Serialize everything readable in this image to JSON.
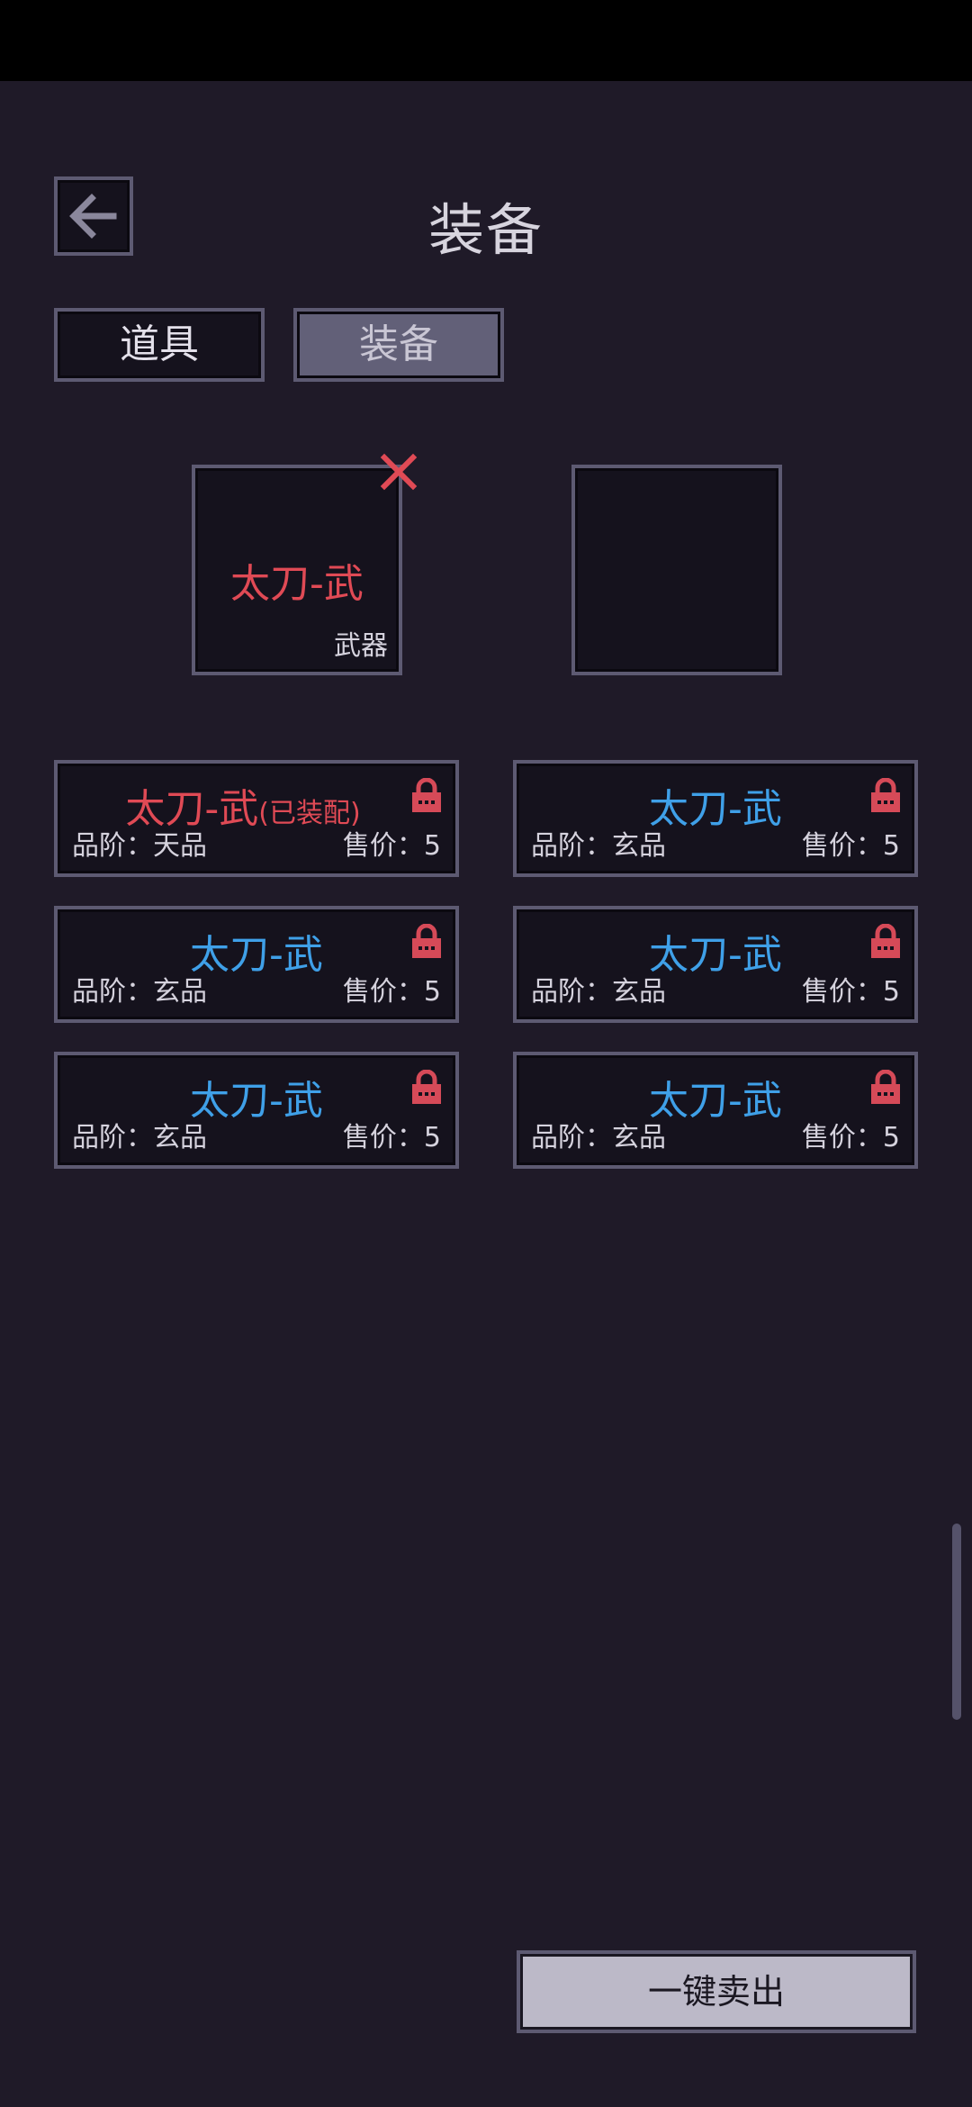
{
  "header": {
    "title": "装备"
  },
  "tabs": [
    {
      "label": "道具",
      "active": false
    },
    {
      "label": "装备",
      "active": true
    }
  ],
  "slots": {
    "weapon": {
      "name": "太刀-武",
      "type": "武器"
    }
  },
  "items": [
    {
      "name": "太刀-武",
      "equipped_tag": "(已装配)",
      "grade": "品阶：天品",
      "price": "售价：5",
      "color": "#e04a55"
    },
    {
      "name": "太刀-武",
      "grade": "品阶：玄品",
      "price": "售价：5",
      "color": "#3fa0e8"
    },
    {
      "name": "太刀-武",
      "grade": "品阶：玄品",
      "price": "售价：5",
      "color": "#3fa0e8"
    },
    {
      "name": "太刀-武",
      "grade": "品阶：玄品",
      "price": "售价：5",
      "color": "#3fa0e8"
    },
    {
      "name": "太刀-武",
      "grade": "品阶：玄品",
      "price": "售价：5",
      "color": "#3fa0e8"
    },
    {
      "name": "太刀-武",
      "grade": "品阶：玄品",
      "price": "售价：5",
      "color": "#3fa0e8"
    }
  ],
  "footer": {
    "sell_all_label": "一键卖出"
  },
  "icons": {
    "back": "back-arrow-icon",
    "unequip": "close-icon",
    "lock": "lock-icon"
  },
  "colors": {
    "background": "#1f1a28",
    "border": "#5d5a72",
    "equipped": "#e04a55",
    "item": "#3fa0e8"
  }
}
